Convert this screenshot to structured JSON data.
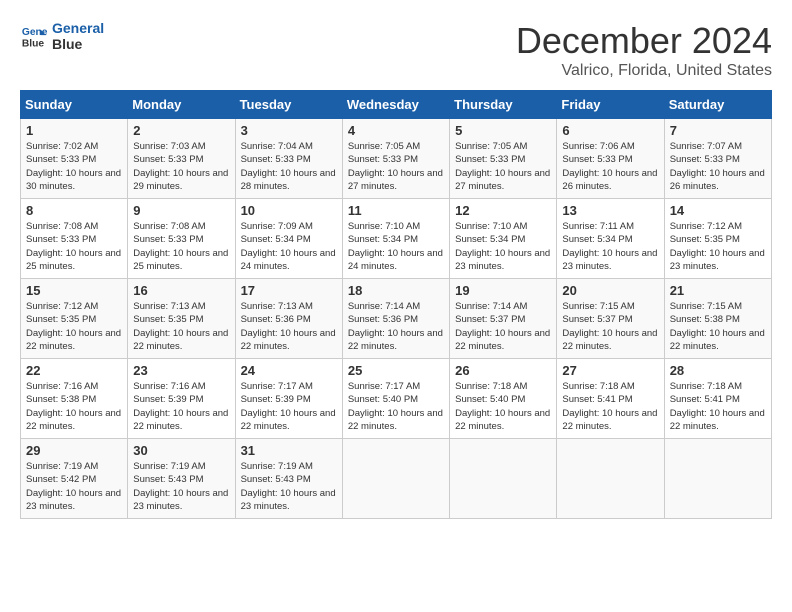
{
  "header": {
    "logo_line1": "General",
    "logo_line2": "Blue",
    "title": "December 2024",
    "subtitle": "Valrico, Florida, United States"
  },
  "calendar": {
    "headers": [
      "Sunday",
      "Monday",
      "Tuesday",
      "Wednesday",
      "Thursday",
      "Friday",
      "Saturday"
    ],
    "weeks": [
      [
        {
          "day": "",
          "info": ""
        },
        {
          "day": "2",
          "info": "Sunrise: 7:03 AM\nSunset: 5:33 PM\nDaylight: 10 hours\nand 29 minutes."
        },
        {
          "day": "3",
          "info": "Sunrise: 7:04 AM\nSunset: 5:33 PM\nDaylight: 10 hours\nand 28 minutes."
        },
        {
          "day": "4",
          "info": "Sunrise: 7:05 AM\nSunset: 5:33 PM\nDaylight: 10 hours\nand 27 minutes."
        },
        {
          "day": "5",
          "info": "Sunrise: 7:05 AM\nSunset: 5:33 PM\nDaylight: 10 hours\nand 27 minutes."
        },
        {
          "day": "6",
          "info": "Sunrise: 7:06 AM\nSunset: 5:33 PM\nDaylight: 10 hours\nand 26 minutes."
        },
        {
          "day": "7",
          "info": "Sunrise: 7:07 AM\nSunset: 5:33 PM\nDaylight: 10 hours\nand 26 minutes."
        }
      ],
      [
        {
          "day": "1",
          "info": "Sunrise: 7:02 AM\nSunset: 5:33 PM\nDaylight: 10 hours\nand 30 minutes."
        },
        {
          "day": "",
          "info": ""
        },
        {
          "day": "",
          "info": ""
        },
        {
          "day": "",
          "info": ""
        },
        {
          "day": "",
          "info": ""
        },
        {
          "day": "",
          "info": ""
        },
        {
          "day": "",
          "info": ""
        }
      ],
      [
        {
          "day": "8",
          "info": "Sunrise: 7:08 AM\nSunset: 5:33 PM\nDaylight: 10 hours\nand 25 minutes."
        },
        {
          "day": "9",
          "info": "Sunrise: 7:08 AM\nSunset: 5:33 PM\nDaylight: 10 hours\nand 25 minutes."
        },
        {
          "day": "10",
          "info": "Sunrise: 7:09 AM\nSunset: 5:34 PM\nDaylight: 10 hours\nand 24 minutes."
        },
        {
          "day": "11",
          "info": "Sunrise: 7:10 AM\nSunset: 5:34 PM\nDaylight: 10 hours\nand 24 minutes."
        },
        {
          "day": "12",
          "info": "Sunrise: 7:10 AM\nSunset: 5:34 PM\nDaylight: 10 hours\nand 23 minutes."
        },
        {
          "day": "13",
          "info": "Sunrise: 7:11 AM\nSunset: 5:34 PM\nDaylight: 10 hours\nand 23 minutes."
        },
        {
          "day": "14",
          "info": "Sunrise: 7:12 AM\nSunset: 5:35 PM\nDaylight: 10 hours\nand 23 minutes."
        }
      ],
      [
        {
          "day": "15",
          "info": "Sunrise: 7:12 AM\nSunset: 5:35 PM\nDaylight: 10 hours\nand 22 minutes."
        },
        {
          "day": "16",
          "info": "Sunrise: 7:13 AM\nSunset: 5:35 PM\nDaylight: 10 hours\nand 22 minutes."
        },
        {
          "day": "17",
          "info": "Sunrise: 7:13 AM\nSunset: 5:36 PM\nDaylight: 10 hours\nand 22 minutes."
        },
        {
          "day": "18",
          "info": "Sunrise: 7:14 AM\nSunset: 5:36 PM\nDaylight: 10 hours\nand 22 minutes."
        },
        {
          "day": "19",
          "info": "Sunrise: 7:14 AM\nSunset: 5:37 PM\nDaylight: 10 hours\nand 22 minutes."
        },
        {
          "day": "20",
          "info": "Sunrise: 7:15 AM\nSunset: 5:37 PM\nDaylight: 10 hours\nand 22 minutes."
        },
        {
          "day": "21",
          "info": "Sunrise: 7:15 AM\nSunset: 5:38 PM\nDaylight: 10 hours\nand 22 minutes."
        }
      ],
      [
        {
          "day": "22",
          "info": "Sunrise: 7:16 AM\nSunset: 5:38 PM\nDaylight: 10 hours\nand 22 minutes."
        },
        {
          "day": "23",
          "info": "Sunrise: 7:16 AM\nSunset: 5:39 PM\nDaylight: 10 hours\nand 22 minutes."
        },
        {
          "day": "24",
          "info": "Sunrise: 7:17 AM\nSunset: 5:39 PM\nDaylight: 10 hours\nand 22 minutes."
        },
        {
          "day": "25",
          "info": "Sunrise: 7:17 AM\nSunset: 5:40 PM\nDaylight: 10 hours\nand 22 minutes."
        },
        {
          "day": "26",
          "info": "Sunrise: 7:18 AM\nSunset: 5:40 PM\nDaylight: 10 hours\nand 22 minutes."
        },
        {
          "day": "27",
          "info": "Sunrise: 7:18 AM\nSunset: 5:41 PM\nDaylight: 10 hours\nand 22 minutes."
        },
        {
          "day": "28",
          "info": "Sunrise: 7:18 AM\nSunset: 5:41 PM\nDaylight: 10 hours\nand 22 minutes."
        }
      ],
      [
        {
          "day": "29",
          "info": "Sunrise: 7:19 AM\nSunset: 5:42 PM\nDaylight: 10 hours\nand 23 minutes."
        },
        {
          "day": "30",
          "info": "Sunrise: 7:19 AM\nSunset: 5:43 PM\nDaylight: 10 hours\nand 23 minutes."
        },
        {
          "day": "31",
          "info": "Sunrise: 7:19 AM\nSunset: 5:43 PM\nDaylight: 10 hours\nand 23 minutes."
        },
        {
          "day": "",
          "info": ""
        },
        {
          "day": "",
          "info": ""
        },
        {
          "day": "",
          "info": ""
        },
        {
          "day": "",
          "info": ""
        }
      ]
    ]
  }
}
